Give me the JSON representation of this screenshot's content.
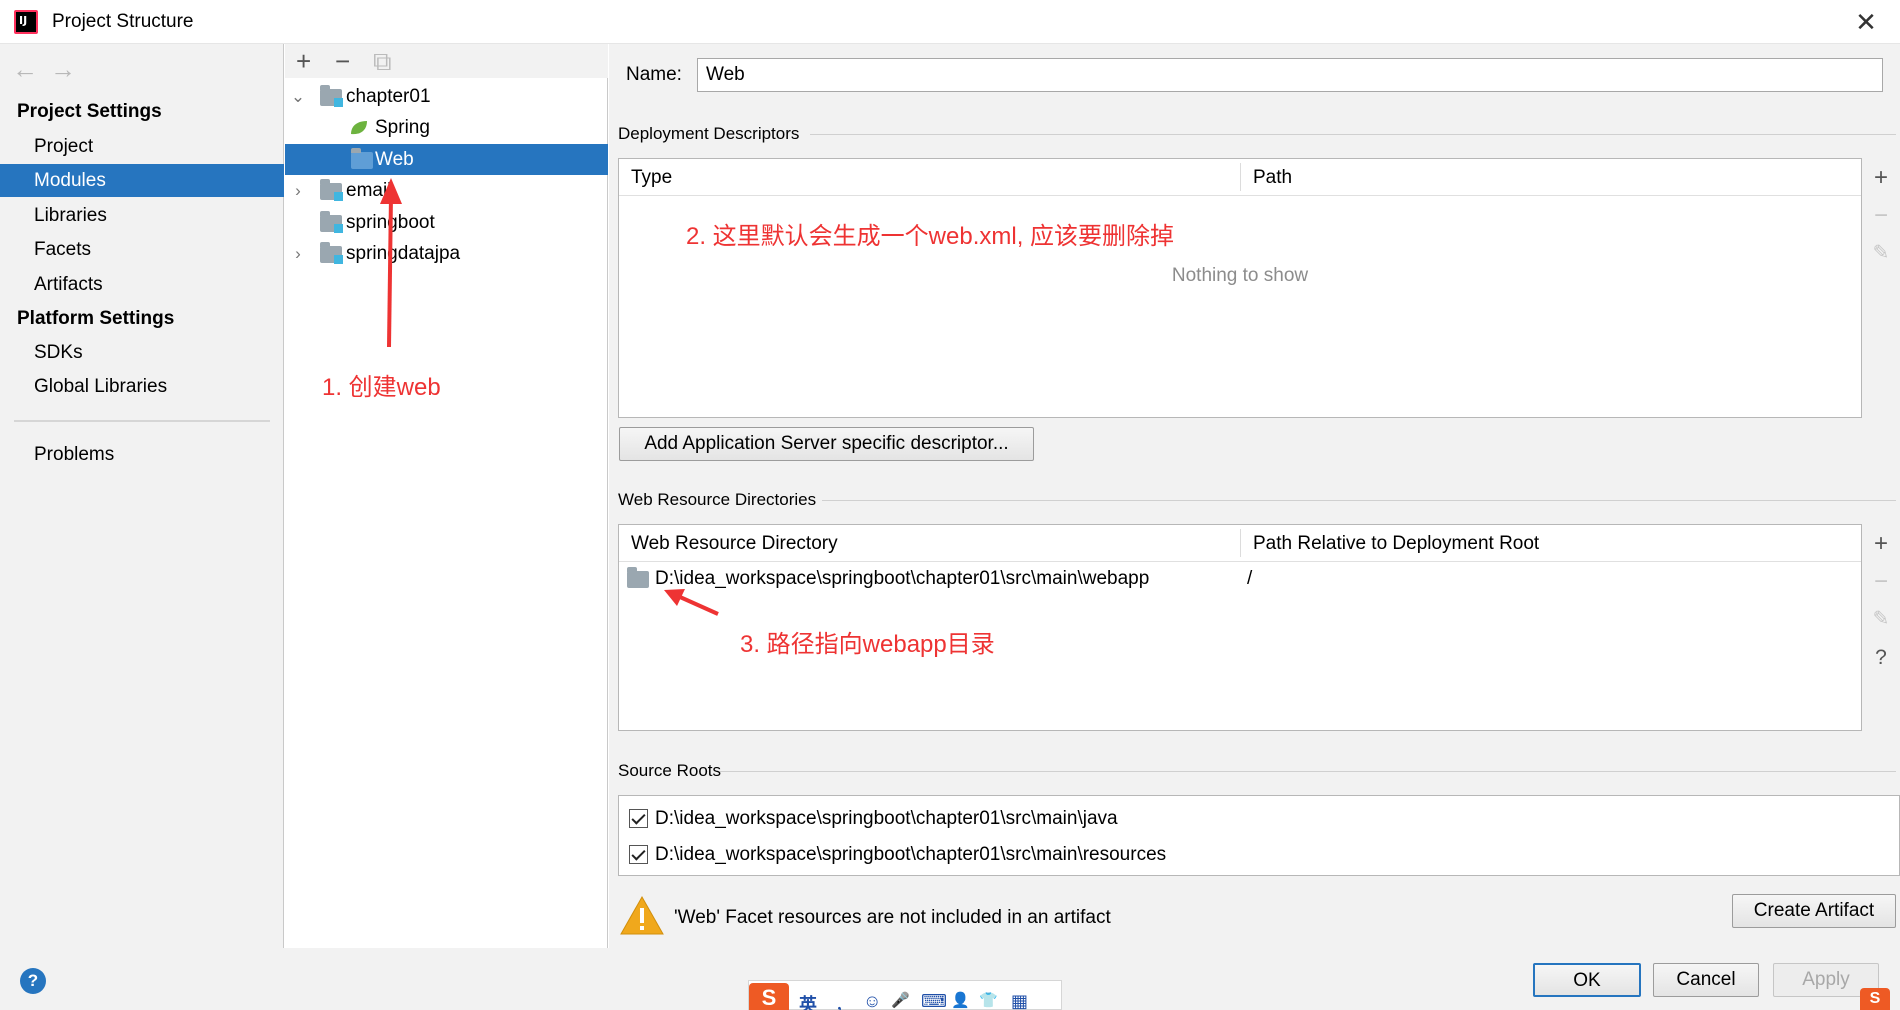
{
  "window": {
    "title": "Project Structure",
    "app_icon": "intellij-icon"
  },
  "nav": {
    "back_icon": "←",
    "forward_icon": "→",
    "section_project": "Project Settings",
    "items_project": [
      "Project",
      "Modules",
      "Libraries",
      "Facets",
      "Artifacts"
    ],
    "selected": "Modules",
    "section_platform": "Platform Settings",
    "items_platform": [
      "SDKs",
      "Global Libraries"
    ],
    "problems": "Problems"
  },
  "tree": {
    "toolbar": {
      "add": "+",
      "remove": "−",
      "copy": "⧉"
    },
    "nodes": [
      "chapter01",
      "Spring",
      "Web",
      "email",
      "springboot",
      "springdatajpa"
    ],
    "selected": "Web"
  },
  "facet": {
    "name_label": "Name:",
    "name_value": "Web",
    "deployment": {
      "title": "Deployment Descriptors",
      "col_type": "Type",
      "col_path": "Path",
      "empty": "Nothing to show",
      "add_button": "Add Application Server specific descriptor..."
    },
    "web_resources": {
      "title": "Web Resource Directories",
      "col_dir": "Web Resource Directory",
      "col_rel": "Path Relative to Deployment Root",
      "row_dir": "D:\\idea_workspace\\springboot\\chapter01\\src\\main\\webapp",
      "row_rel": "/",
      "help": "?"
    },
    "source_roots": {
      "title": "Source Roots",
      "items": [
        "D:\\idea_workspace\\springboot\\chapter01\\src\\main\\java",
        "D:\\idea_workspace\\springboot\\chapter01\\src\\main\\resources"
      ]
    },
    "warning": "'Web' Facet resources are not included in an artifact",
    "create_artifact": "Create Artifact"
  },
  "annotations": {
    "a1": "1. 创建web",
    "a2": "2. 这里默认会生成一个web.xml, 应该要删除掉",
    "a3": "3. 路径指向webapp目录"
  },
  "buttons": {
    "ok": "OK",
    "cancel": "Cancel",
    "apply": "Apply",
    "help": "?"
  },
  "ime": {
    "logo": "S",
    "lang": "英",
    "icons": [
      "，",
      "☺",
      "🎤",
      "⌨",
      "👤",
      "👕",
      "▦"
    ]
  },
  "colors": {
    "selection": "#2675bf",
    "annotation": "#ee3333",
    "warning": "#f0a81c"
  }
}
